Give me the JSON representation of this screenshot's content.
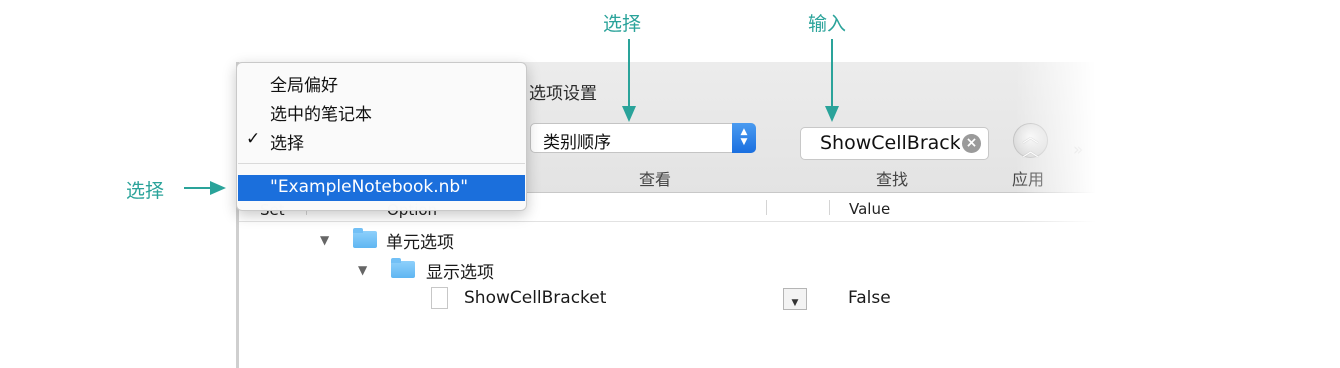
{
  "annotations": {
    "top_select_label": "选择",
    "top_input_label": "输入",
    "left_select_label": "选择"
  },
  "colors": {
    "annotation": "#2aa39a",
    "selection_highlight": "#1b6fdc",
    "popup_accent": "#1a6fe0",
    "folder": "#6cbcf4"
  },
  "menu": {
    "items": [
      {
        "label": "全局偏好",
        "checked": false
      },
      {
        "label": "选中的笔记本",
        "checked": false
      },
      {
        "label": "选择",
        "checked": true
      }
    ],
    "check_glyph": "✓",
    "highlighted_item": "\"ExampleNotebook.nb\""
  },
  "toolbar": {
    "title": "选项设置",
    "view_popup_value": "类别顺序",
    "view_label": "查看",
    "search_value": "ShowCellBracket",
    "search_label": "查找",
    "apply_label": "应用",
    "overflow_glyph": "»"
  },
  "table": {
    "headers": {
      "set": "Set",
      "option": "Option",
      "value": "Value"
    },
    "rows": [
      {
        "label": "单元选项",
        "icon": "folder-icon",
        "expanded": true,
        "value": ""
      },
      {
        "label": "显示选项",
        "icon": "folder-icon",
        "expanded": true,
        "value": ""
      },
      {
        "label": "ShowCellBracket",
        "icon": "document-icon",
        "expanded": false,
        "value": "False"
      }
    ]
  }
}
